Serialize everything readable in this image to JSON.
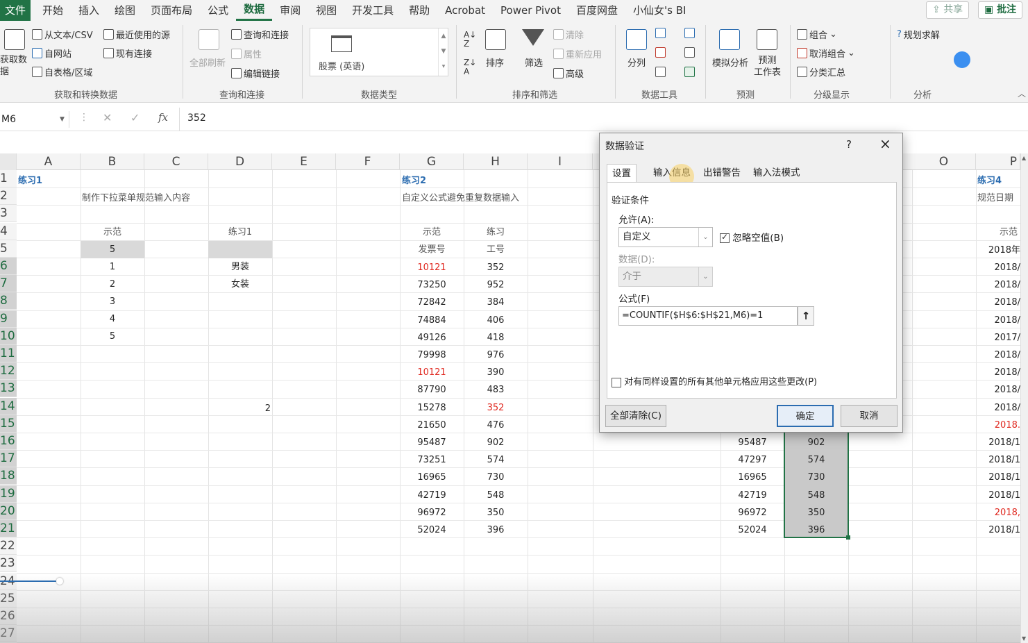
{
  "menu": {
    "file": "文件",
    "items": [
      "开始",
      "插入",
      "绘图",
      "页面布局",
      "公式",
      "数据",
      "审阅",
      "视图",
      "开发工具",
      "帮助",
      "Acrobat",
      "Power Pivot",
      "百度网盘",
      "小仙女's BI"
    ],
    "share": "共享",
    "comment": "批注"
  },
  "ribbon": {
    "get": {
      "big": "获取数\n据",
      "label": "获取和转换数据",
      "items": [
        "从文本/CSV",
        "自网站",
        "自表格/区域",
        "最近使用的源",
        "现有连接"
      ]
    },
    "query": {
      "big": "全部刷新",
      "label": "查询和连接",
      "items": [
        "查询和连接",
        "属性",
        "编辑链接"
      ]
    },
    "dtype": {
      "stock": "股票 (英语)",
      "label": "数据类型"
    },
    "sort": {
      "sort": "排序",
      "filter": "筛选",
      "clear": "清除",
      "reapply": "重新应用",
      "advanced": "高级",
      "label": "排序和筛选"
    },
    "tools": {
      "split": "分列",
      "label": "数据工具"
    },
    "forecast": {
      "whatif": "模拟分析",
      "sheet": "预测\n工作表",
      "label": "预测"
    },
    "outline": {
      "group": "组合",
      "ungroup": "取消组合",
      "subtotal": "分类汇总",
      "label": "分级显示"
    },
    "analysis": {
      "solver": "规划求解",
      "label": "分析"
    }
  },
  "formula": {
    "namebox": "M6",
    "fx": "fx",
    "value": "352"
  },
  "columns": [
    "A",
    "B",
    "C",
    "D",
    "E",
    "F",
    "G",
    "H",
    "I",
    "O",
    "P"
  ],
  "rows": [
    "1",
    "2",
    "3",
    "4",
    "5",
    "6",
    "7",
    "8",
    "9",
    "10",
    "11",
    "12",
    "13",
    "14",
    "15",
    "16",
    "17",
    "18",
    "19",
    "20",
    "21",
    "22",
    "23",
    "24",
    "25",
    "26",
    "27"
  ],
  "sheet": {
    "ex1": {
      "title": "练习1",
      "desc": "制作下拉菜单规范输入内容",
      "demo": "示范",
      "practice": "练习1",
      "b5": "5",
      "b": [
        "1",
        "2",
        "3",
        "4",
        "5"
      ],
      "d": [
        "男装",
        "女装"
      ],
      "d14": "2"
    },
    "ex2": {
      "title": "练习2",
      "desc": "自定义公式避免重复数据输入",
      "demo": "示范",
      "practice": "练习",
      "col_g": "发票号",
      "col_h": "工号",
      "g": [
        "10121",
        "73250",
        "72842",
        "74884",
        "49126",
        "79998",
        "10121",
        "87790",
        "15278",
        "21650",
        "95487",
        "73251",
        "16965",
        "42719",
        "96972",
        "52024"
      ],
      "h": [
        "352",
        "952",
        "384",
        "406",
        "418",
        "976",
        "390",
        "483",
        "352",
        "476",
        "902",
        "574",
        "730",
        "548",
        "350",
        "396"
      ]
    },
    "rightcols": {
      "n": [
        "95487",
        "47297",
        "16965",
        "42719",
        "96972",
        "52024"
      ],
      "o": [
        "902",
        "574",
        "730",
        "548",
        "350",
        "396"
      ]
    },
    "ex4": {
      "title": "练习4",
      "desc": "规范日期",
      "demo": "示范",
      "dates": [
        "2018年",
        "2018/",
        "2018/",
        "2018/",
        "2018/",
        "2017/",
        "2018/",
        "2018/",
        "2018/",
        "2018/",
        "2018.",
        "2018/1",
        "2018/1",
        "2018/1",
        "2018/1",
        "2018,",
        "2018/1"
      ]
    }
  },
  "dialog": {
    "title": "数据验证",
    "help": "?",
    "close": "×",
    "tabs": [
      "设置",
      "输入信息",
      "出错警告",
      "输入法模式"
    ],
    "criteria": "验证条件",
    "allow_label": "允许(A):",
    "allow_value": "自定义",
    "ignore_blank": "忽略空值(B)",
    "data_label": "数据(D):",
    "data_value": "介于",
    "formula_label": "公式(F)",
    "formula_value": "=COUNTIF($H$6:$H$21,M6)=1",
    "apply_all": "对有同样设置的所有其他单元格应用这些更改(P)",
    "clear_all": "全部清除(C)",
    "ok": "确定",
    "cancel": "取消"
  },
  "colors": {
    "accent": "#217346",
    "red": "#e0281f",
    "blue": "#2b6cb0"
  }
}
